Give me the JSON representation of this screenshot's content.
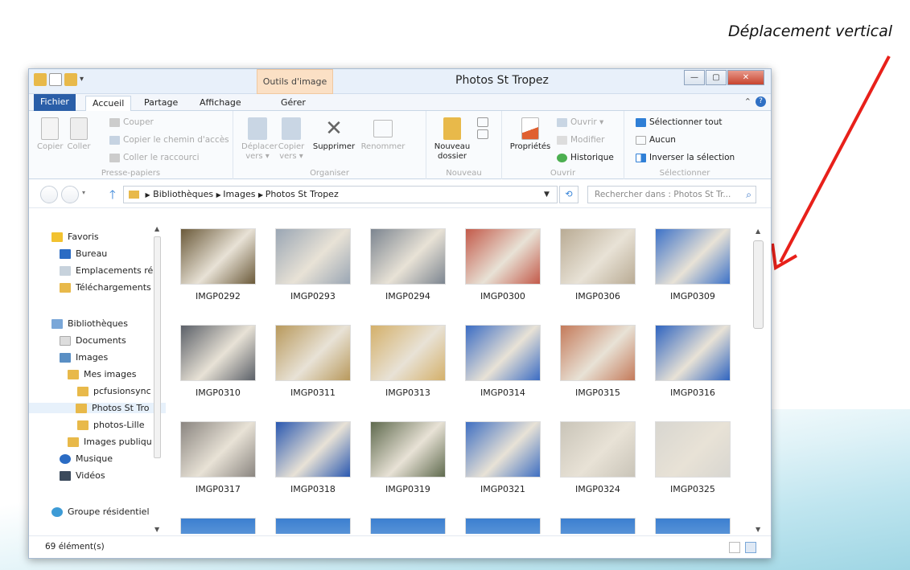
{
  "caption": "Déplacement vertical",
  "window": {
    "title": "Photos St Tropez",
    "tool_tab": "Outils d'image",
    "qat_menu": "▾"
  },
  "tabs": {
    "file": "Fichier",
    "home": "Accueil",
    "share": "Partage",
    "view": "Affichage",
    "manage": "Gérer"
  },
  "ribbon": {
    "copy": "Copier",
    "paste": "Coller",
    "cut": "Couper",
    "copy_path": "Copier le chemin d'accès",
    "paste_shortcut": "Coller le raccourci",
    "group_clipboard": "Presse-papiers",
    "move_to": "Déplacer vers ▾",
    "copy_to": "Copier vers ▾",
    "delete": "Supprimer",
    "rename": "Renommer",
    "group_organize": "Organiser",
    "new_folder": "Nouveau dossier",
    "group_new": "Nouveau",
    "properties": "Propriétés",
    "open": "Ouvrir ▾",
    "edit": "Modifier",
    "history": "Historique",
    "group_open": "Ouvrir",
    "select_all": "Sélectionner tout",
    "select_none": "Aucun",
    "invert_selection": "Inverser la sélection",
    "group_select": "Sélectionner"
  },
  "address": {
    "path": [
      "Bibliothèques",
      "Images",
      "Photos St Tropez"
    ],
    "search_placeholder": "Rechercher dans : Photos St Tr..."
  },
  "nav": {
    "favorites": "Favoris",
    "desktop": "Bureau",
    "recent": "Emplacements ré",
    "downloads": "Téléchargements",
    "libraries": "Bibliothèques",
    "documents": "Documents",
    "images": "Images",
    "my_images": "Mes images",
    "pcfusion": "pcfusionsync",
    "photos_st": "Photos St Tro",
    "photos_lille": "photos-Lille",
    "public_images": "Images publiqu",
    "music": "Musique",
    "videos": "Vidéos",
    "homegroup": "Groupe résidentiel"
  },
  "files": [
    {
      "name": "IMGP0292",
      "color": "#6b5a3a"
    },
    {
      "name": "IMGP0293",
      "color": "#9aa6b4"
    },
    {
      "name": "IMGP0294",
      "color": "#7c8590"
    },
    {
      "name": "IMGP0300",
      "color": "#c35a4a"
    },
    {
      "name": "IMGP0306",
      "color": "#b9ab94"
    },
    {
      "name": "IMGP0309",
      "color": "#3d72c8"
    },
    {
      "name": "IMGP0310",
      "color": "#5b6068"
    },
    {
      "name": "IMGP0311",
      "color": "#b8995c"
    },
    {
      "name": "IMGP0313",
      "color": "#d4b06a"
    },
    {
      "name": "IMGP0314",
      "color": "#3b6cc4"
    },
    {
      "name": "IMGP0315",
      "color": "#c47a5a"
    },
    {
      "name": "IMGP0316",
      "color": "#2f64c0"
    },
    {
      "name": "IMGP0317",
      "color": "#8a8580"
    },
    {
      "name": "IMGP0318",
      "color": "#2a58b0"
    },
    {
      "name": "IMGP0319",
      "color": "#5f6a4e"
    },
    {
      "name": "IMGP0321",
      "color": "#3f6fc2"
    },
    {
      "name": "IMGP0324",
      "color": "#c9c4b8"
    },
    {
      "name": "IMGP0325",
      "color": "#d8d6d0"
    }
  ],
  "status": {
    "count": "69 élément(s)"
  }
}
